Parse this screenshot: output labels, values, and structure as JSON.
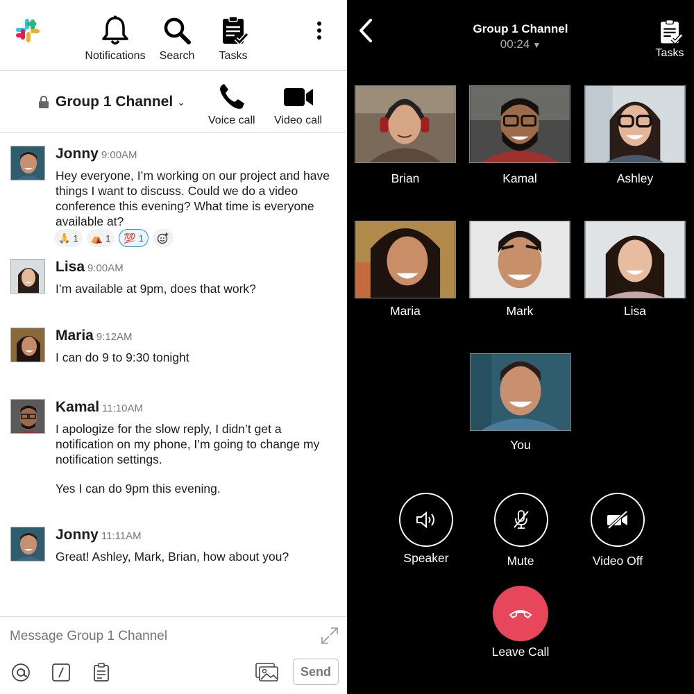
{
  "left": {
    "nav": {
      "notifications_label": "Notifications",
      "search_label": "Search",
      "tasks_label": "Tasks"
    },
    "channel": {
      "title": "Group 1 Channel",
      "caret": "⌄",
      "voice_call_label": "Voice call",
      "video_call_label": "Video call"
    },
    "messages": [
      {
        "author": "Jonny",
        "time": "9:00AM",
        "text": "Hey everyone, I’m working on our project and have things I want to discuss.  Could we do a video conference this evening?  What time is everyone available at?",
        "reactions": [
          {
            "emoji": "🙏",
            "count": "1"
          },
          {
            "emoji": "⛺",
            "count": "1"
          },
          {
            "emoji": "💯",
            "count": "1"
          }
        ]
      },
      {
        "author": "Lisa",
        "time": "9:00AM",
        "text": "I’m available at 9pm, does that work?"
      },
      {
        "author": "Maria",
        "time": "9:12AM",
        "text": "I can do 9 to 9:30 tonight"
      },
      {
        "author": "Kamal",
        "time": "11:10AM",
        "text": "I apologize for the slow reply, I didn’t get a notification on my phone, I’m going to change my notification settings.",
        "text2": "Yes I can do 9pm this evening."
      },
      {
        "author": "Jonny",
        "time": "11:11AM",
        "text": "Great!  Ashley, Mark, Brian, how about you?"
      }
    ],
    "composer": {
      "placeholder": "Message Group 1 Channel",
      "send_label": "Send"
    }
  },
  "right": {
    "call": {
      "title": "Group 1 Channel",
      "timer": "00:24",
      "tasks_label": "Tasks"
    },
    "participants": [
      "Brian",
      "Kamal",
      "Ashley",
      "Maria",
      "Mark",
      "Lisa",
      "You"
    ],
    "controls": {
      "speaker_label": "Speaker",
      "mute_label": "Mute",
      "video_off_label": "Video Off",
      "leave_label": "Leave Call"
    }
  },
  "colors": {
    "accent_blue": "#1d9bd1",
    "leave_red": "#e8465b",
    "call_bg": "#000000"
  }
}
